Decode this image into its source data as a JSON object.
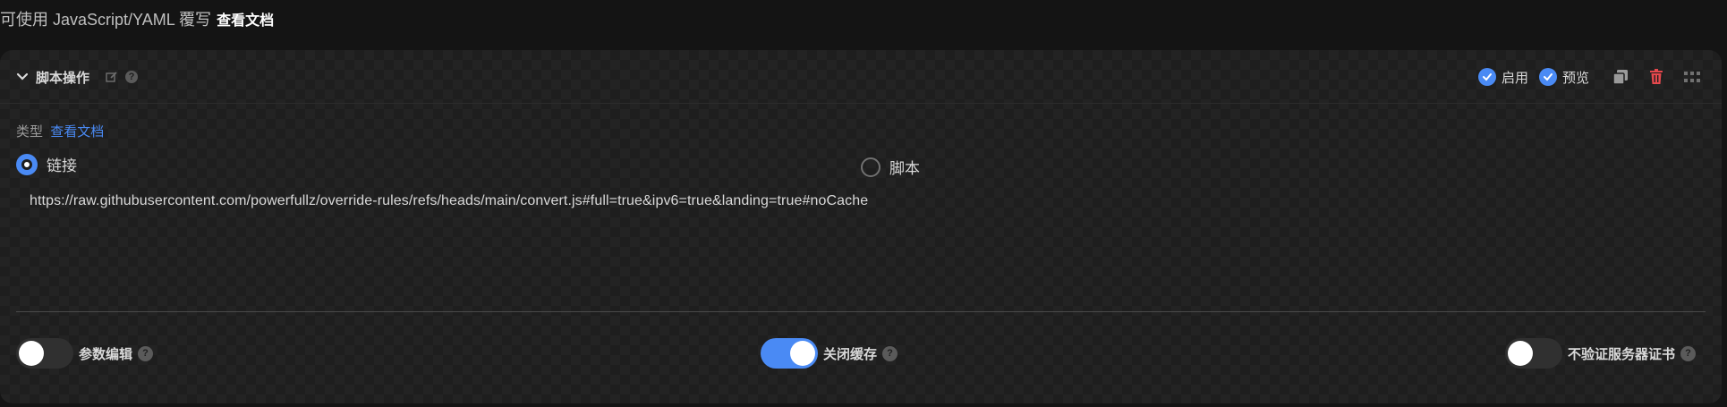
{
  "top": {
    "prefix": "可使用 JavaScript/YAML 覆写",
    "doc_link": "查看文档"
  },
  "card": {
    "title": "脚本操作",
    "enable_label": "启用",
    "preview_label": "预览",
    "icons": [
      "chevron-down-icon",
      "edit-icon",
      "help-icon",
      "check-icon",
      "copy-icon",
      "trash-icon",
      "drag-grid-icon"
    ],
    "accent_color": "#4a8af4",
    "danger_color": "#e5484d"
  },
  "type_section": {
    "label": "类型",
    "doc_link": "查看文档",
    "options": [
      {
        "label": "链接",
        "selected": true
      },
      {
        "label": "脚本",
        "selected": false
      }
    ]
  },
  "url": "https://raw.githubusercontent.com/powerfullz/override-rules/refs/heads/main/convert.js#full=true&ipv6=true&landing=true#noCache",
  "toggles": [
    {
      "label": "参数编辑",
      "on": false
    },
    {
      "label": "关闭缓存",
      "on": true
    },
    {
      "label": "不验证服务器证书",
      "on": false
    }
  ]
}
